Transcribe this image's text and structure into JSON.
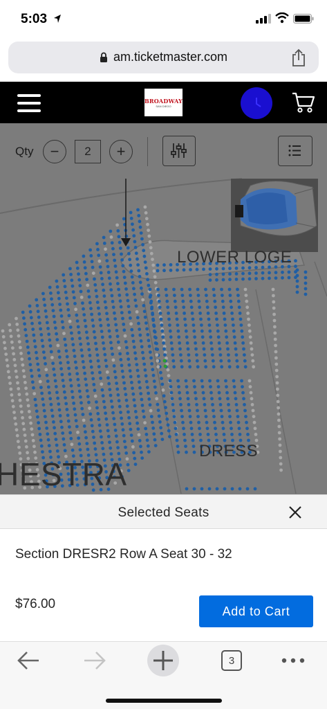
{
  "status_bar": {
    "time": "5:03"
  },
  "browser": {
    "url": "am.ticketmaster.com",
    "open_tabs": "3"
  },
  "header": {
    "logo_text": "BROADWAY",
    "logo_subtext": "SAN DIEGO"
  },
  "toolbar": {
    "qty_label": "Qty",
    "minus": "−",
    "plus": "+",
    "qty_value": "2"
  },
  "map": {
    "section_labels": {
      "lower_loge": "LOWER LOGE",
      "dress": "DRESS",
      "orchestra": "HESTRA"
    }
  },
  "selected": {
    "title": "Selected Seats",
    "prefix_section": "Section",
    "section": "DRESR2",
    "prefix_row": "Row",
    "row": "A",
    "prefix_seat": "Seat",
    "seats": "30 - 32",
    "price": "$76.00",
    "add_label": "Add to Cart"
  },
  "colors": {
    "available_seat": "#1f5fa5",
    "unavailable_seat": "#a8a8a8",
    "selected_seat": "#2e9e2e",
    "primary_button": "#026cdf",
    "header_bg": "#000000"
  }
}
